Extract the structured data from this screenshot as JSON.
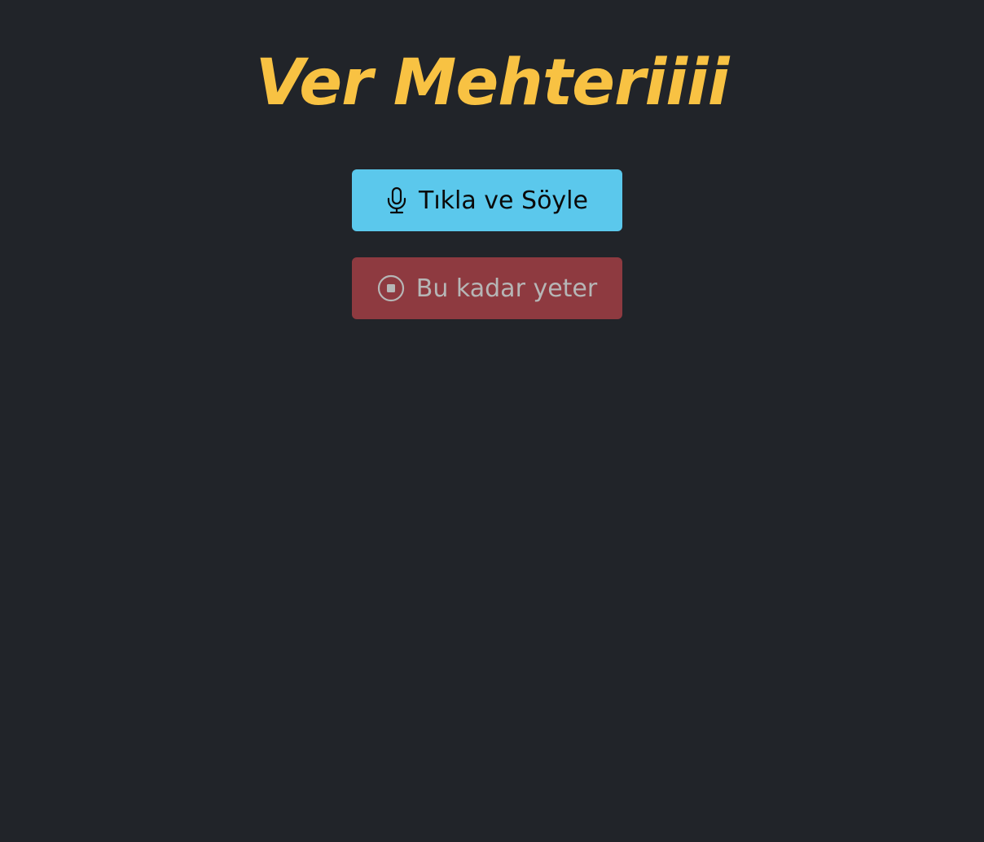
{
  "page": {
    "title": "Ver Mehteriiii"
  },
  "buttons": {
    "start": {
      "label": "Tıkla ve Söyle",
      "icon": "microphone-icon"
    },
    "stop": {
      "label": "Bu kadar yeter",
      "icon": "stop-circle-icon"
    }
  },
  "colors": {
    "background": "#212429",
    "title": "#f8c243",
    "start_button": "#5bc8ec",
    "stop_button": "#8e3a40",
    "stop_text": "#b6b6b6"
  }
}
